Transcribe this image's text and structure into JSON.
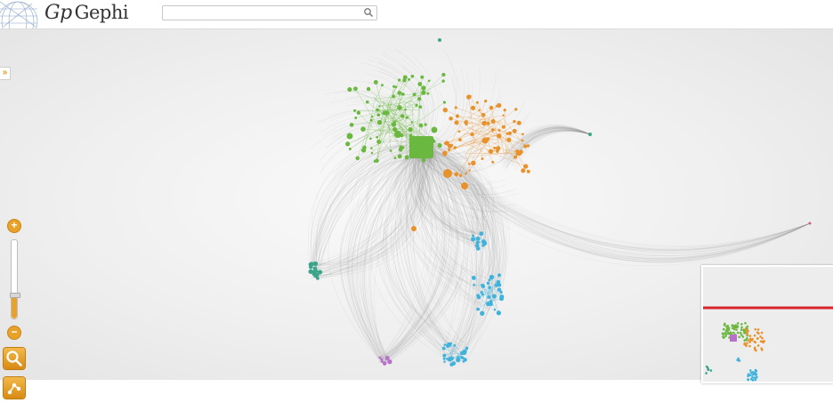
{
  "header": {
    "logo_mark": "Gp",
    "logo_text": "Gephi",
    "search_placeholder": "",
    "search_value": ""
  },
  "sidebar": {
    "expand_label": "»",
    "zoom_in_label": "+",
    "zoom_out_label": "−",
    "zoom_level": 0.28,
    "icons": [
      "search-icon",
      "layout-icon"
    ]
  },
  "colors": {
    "accent": "#e8a22a",
    "edge": "#8a8a8a",
    "clusters": {
      "green": "#6ab83f",
      "orange": "#e8922b",
      "cyan": "#3fb3dc",
      "teal": "#3aa58a",
      "purple": "#b870c8",
      "pink": "#d45c8a"
    },
    "minimap_viewport": "#d6262c"
  }
}
